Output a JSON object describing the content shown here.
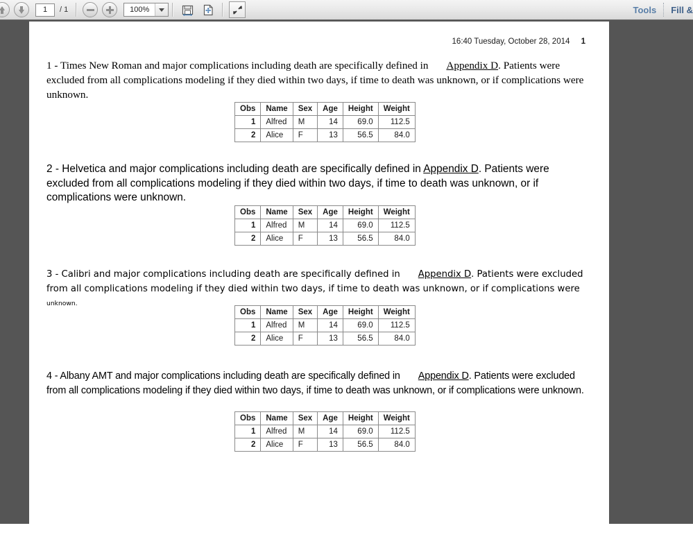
{
  "toolbar": {
    "prev_page_icon": "arrow-up-icon",
    "next_page_icon": "arrow-down-icon",
    "page_number": "1",
    "page_total": "/ 1",
    "zoom_out_icon": "minus-circle-icon",
    "zoom_in_icon": "plus-circle-icon",
    "zoom_level": "100%",
    "zoom_caret_icon": "chevron-down-icon",
    "save_icon": "save-icon",
    "fit_page_icon": "fit-page-icon",
    "fullscreen_icon": "expand-arrows-icon",
    "tools_label": "Tools",
    "fill_label": "Fill &",
    "accent_color": "#5a7fa8"
  },
  "document": {
    "header_timestamp": "16:40 Tuesday, October 28, 2014",
    "header_page": "1",
    "background_color": "#555555",
    "page_color": "#ffffff",
    "sections": [
      {
        "lead": "1 - Times New Roman and major complications including death are specifically defined in",
        "link": "Appendix D",
        "tail": ". Patients were excluded from all complications modeling if they died within two days, if time to death was unknown, or if complications were unknown."
      },
      {
        "lead": "2 - Helvetica and major complications including death are specifically defined in",
        "link": "Appendix D",
        "tail": ". Patients were excluded from all complications modeling if they died within two days, if time to death was unknown, or if complications were unknown."
      },
      {
        "lead": "3 - Calibri and major complications including death are specifically defined in",
        "link": "Appendix D",
        "tail": ". Patients were excluded from all complications modeling if they died within two days, if time to death was unknown, or if complications were",
        "tail_small": "unknown."
      },
      {
        "lead": "4 - Albany AMT and major complications including death are specifically defined in",
        "link": "Appendix D",
        "tail": ". Patients were excluded from all complications modeling if they died within two days, if time to death was unknown, or if complications were unknown."
      }
    ],
    "table": {
      "columns": [
        "Obs",
        "Name",
        "Sex",
        "Age",
        "Height",
        "Weight"
      ],
      "rows": [
        {
          "obs": "1",
          "name": "Alfred",
          "sex": "M",
          "age": "14",
          "height": "69.0",
          "weight": "112.5"
        },
        {
          "obs": "2",
          "name": "Alice",
          "sex": "F",
          "age": "13",
          "height": "56.5",
          "weight": "84.0"
        }
      ]
    }
  }
}
